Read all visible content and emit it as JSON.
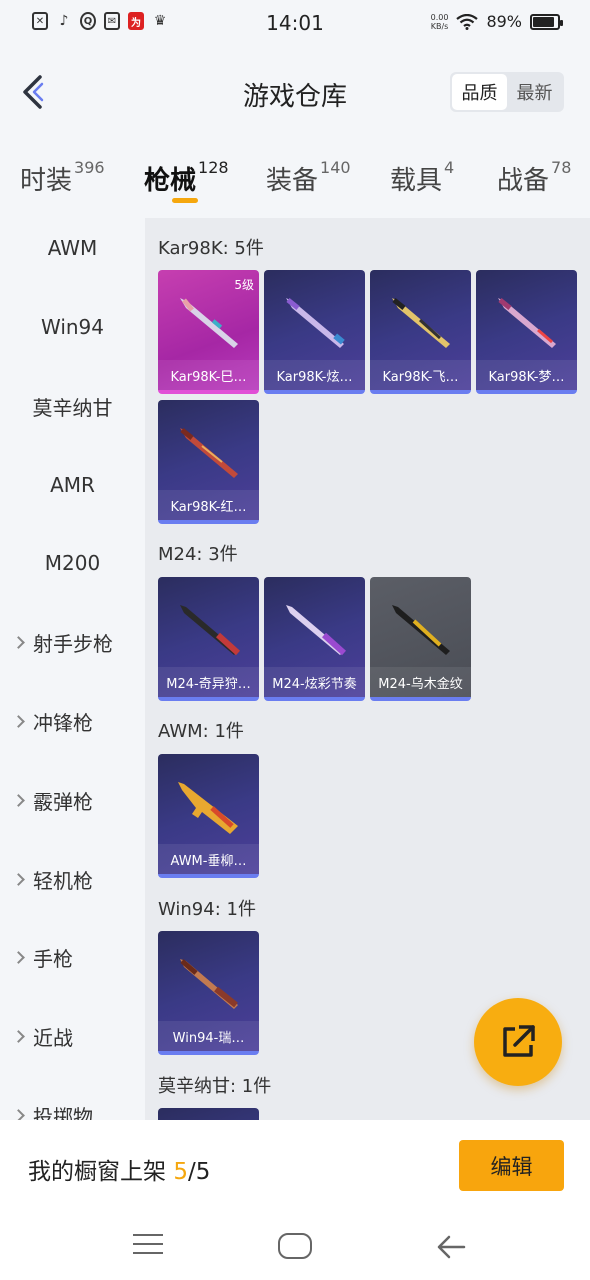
{
  "status_bar": {
    "time": "14:01",
    "net_speed_value": "0.00",
    "net_speed_unit": "KB/s",
    "battery_percent": "89%",
    "battery_level": 0.89
  },
  "header": {
    "title": "游戏仓库",
    "sort_options": [
      "品质",
      "最新"
    ],
    "sort_selected": "品质"
  },
  "tabs": [
    {
      "label": "时装",
      "count": "396"
    },
    {
      "label": "枪械",
      "count": "128",
      "active": true
    },
    {
      "label": "装备",
      "count": "140"
    },
    {
      "label": "载具",
      "count": "4"
    },
    {
      "label": "战备",
      "count": "78"
    }
  ],
  "sidebar": {
    "items": [
      {
        "label": "AWM"
      },
      {
        "label": "Win94"
      },
      {
        "label": "莫辛纳甘"
      },
      {
        "label": "AMR"
      },
      {
        "label": "M200"
      },
      {
        "label": "射手步枪"
      },
      {
        "label": "冲锋枪"
      },
      {
        "label": "霰弹枪"
      },
      {
        "label": "轻机枪"
      },
      {
        "label": "手枪"
      },
      {
        "label": "近战"
      },
      {
        "label": "投掷物"
      }
    ]
  },
  "groups": [
    {
      "title": "Kar98K: 5件",
      "items": [
        {
          "label": "Kar98K-巳…",
          "level": "5级",
          "style": "pink"
        },
        {
          "label": "Kar98K-炫…",
          "style": "blue"
        },
        {
          "label": "Kar98K-飞…",
          "style": "blue"
        },
        {
          "label": "Kar98K-梦…",
          "style": "blue"
        },
        {
          "label": "Kar98K-红…",
          "style": "blue"
        }
      ]
    },
    {
      "title": "M24: 3件",
      "items": [
        {
          "label": "M24-奇异狩…",
          "style": "blue"
        },
        {
          "label": "M24-炫彩节奏",
          "style": "blue"
        },
        {
          "label": "M24-乌木金纹",
          "style": "gray"
        }
      ]
    },
    {
      "title": "AWM: 1件",
      "items": [
        {
          "label": "AWM-垂柳…",
          "style": "blue"
        }
      ]
    },
    {
      "title": "Win94: 1件",
      "items": [
        {
          "label": "Win94-瑞…",
          "style": "blue"
        }
      ]
    },
    {
      "title": "莫辛纳甘: 1件",
      "items": []
    }
  ],
  "bottom": {
    "showcase_prefix": "我的橱窗上架 ",
    "showcase_current": "5",
    "showcase_total": "/5",
    "edit_label": "编辑"
  },
  "colors": {
    "accent": "#f5a70e",
    "card_blue": "#3a3a86",
    "card_pink": "#c63fb0",
    "card_gray": "#5b5e66"
  },
  "icons": {
    "back": "chevron-left-icon",
    "fab": "share-external-icon",
    "nav_menu": "menu-icon",
    "nav_home": "home-icon",
    "nav_back": "back-arrow-icon"
  }
}
